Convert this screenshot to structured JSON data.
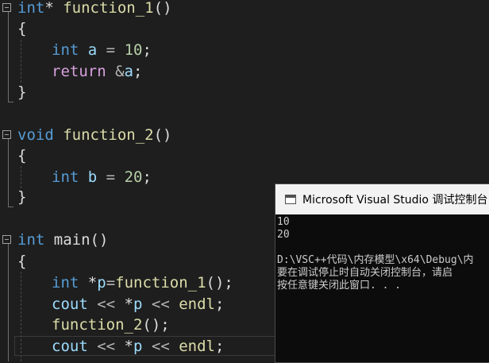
{
  "editor": {
    "fn1": {
      "ret": "int",
      "star": "*",
      "name": "function_1",
      "parens": "()"
    },
    "fn2": {
      "ret": "void",
      "name": "function_2",
      "parens": "()"
    },
    "main": {
      "ret": "int",
      "name": "main",
      "parens": "()"
    },
    "open_brace": "{",
    "close_brace": "}",
    "semi": ";",
    "fn1_body": {
      "decl_type": "int",
      "decl_var": "a",
      "decl_eq": " = ",
      "decl_val": "10",
      "ret_kw": "return",
      "ret_amp": "&",
      "ret_var": "a"
    },
    "fn2_body": {
      "decl_type": "int",
      "decl_var": "b",
      "decl_eq": " = ",
      "decl_val": "20"
    },
    "main_body": {
      "ptr_type": "int",
      "ptr_star": "*",
      "ptr_var": "p",
      "ptr_eq": "=",
      "ptr_call": "function_1",
      "ptr_parens": "()",
      "cout1": "cout",
      "cout1_op1": " << ",
      "cout1_star": "*",
      "cout1_var": "p",
      "cout1_op2": " << ",
      "cout1_endl": "endl",
      "call2": "function_2",
      "call2_parens": "()",
      "cout2": "cout",
      "cout2_op1": " << ",
      "cout2_star": "*",
      "cout2_var": "p",
      "cout2_op2": " << ",
      "cout2_endl": "endl"
    }
  },
  "console": {
    "title": "Microsoft Visual Studio 调试控制台",
    "lines": [
      "10",
      "20",
      "",
      "D:\\VSC++代码\\内存模型\\x64\\Debug\\内",
      "要在调试停止时自动关闭控制台，请启",
      "按任意键关闭此窗口. . ."
    ]
  },
  "colors": {
    "background": "#1e1e1e",
    "keyword": "#569cd6",
    "control_keyword": "#d8a0df",
    "function": "#dcdcaa",
    "variable": "#9cdcfe",
    "number": "#b5cea8",
    "console_bg": "#0c0c0c",
    "console_titlebar": "#f3f3f3"
  }
}
